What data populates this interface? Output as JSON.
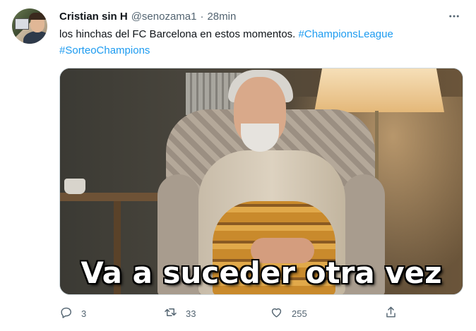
{
  "tweet": {
    "author_name": "Cristian sin H",
    "handle": "@senozama1",
    "separator": "·",
    "time": "28min",
    "text": "los hinchas del FC Barcelona  en estos momentos.",
    "hashtags": [
      "#ChampionsLeague",
      "#SorteoChampions"
    ],
    "media_caption": "Va a suceder otra vez"
  },
  "actions": {
    "replies": "3",
    "retweets": "33",
    "likes": "255"
  },
  "icons": {
    "more": "more-icon",
    "reply": "reply-icon",
    "retweet": "retweet-icon",
    "like": "heart-icon",
    "share": "share-icon"
  },
  "colors": {
    "hashtag": "#1d9bf0",
    "secondary_text": "#536471",
    "primary_text": "#0f1419"
  }
}
